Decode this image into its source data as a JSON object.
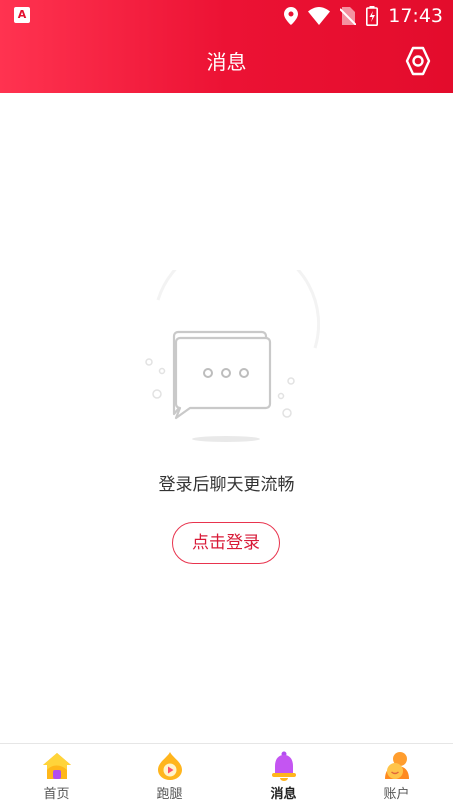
{
  "status_bar": {
    "time": "17:43"
  },
  "header": {
    "title": "消息"
  },
  "empty_state": {
    "message": "登录后聊天更流畅",
    "login_button": "点击登录"
  },
  "tabs": [
    {
      "label": "首页",
      "icon": "home-icon"
    },
    {
      "label": "跑腿",
      "icon": "errand-icon"
    },
    {
      "label": "消息",
      "icon": "bell-icon",
      "active": true
    },
    {
      "label": "账户",
      "icon": "account-icon"
    }
  ],
  "colors": {
    "header_start": "#ff3350",
    "header_end": "#e30c2c",
    "accent": "#d81a37"
  }
}
